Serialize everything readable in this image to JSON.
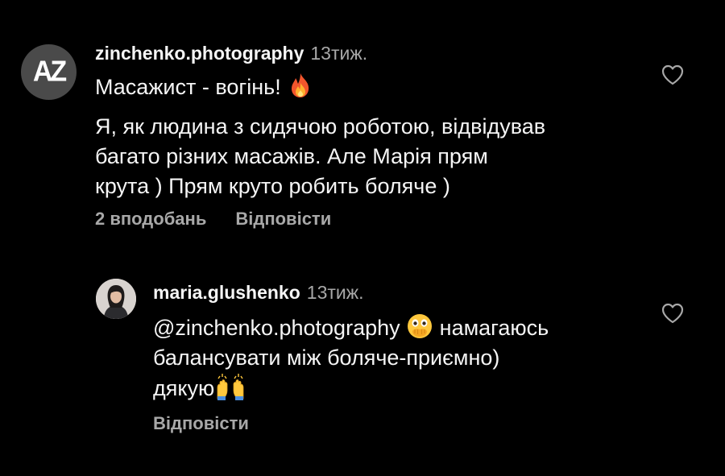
{
  "comment": {
    "avatar_text": "AZ",
    "username": "zinchenko.photography",
    "time": "13тиж.",
    "line1": "Масажист - вогінь!",
    "line1_emoji": "fire-emoji",
    "line2": "Я, як людина з сидячою роботою, відвідував",
    "line3": "багато різних масажів. Але Марія прям",
    "line4": "крута ) Прям круто робить боляче )",
    "likes": "2 вподобань",
    "reply": "Відповісти"
  },
  "reply": {
    "username": "maria.glushenko",
    "time": "13тиж.",
    "mention": "@zinchenko.photography",
    "line1_rest": "намагаюсь",
    "line2": "балансувати між боляче-приємно)",
    "line3": "дякую",
    "emojis": [
      "face-with-open-eyes-and-hand-over-mouth-emoji",
      "raising-hands-emoji"
    ],
    "reply": "Відповісти"
  },
  "colors": {
    "background": "#000000",
    "text": "#f5f5f5",
    "secondary": "#a8a8a8"
  }
}
